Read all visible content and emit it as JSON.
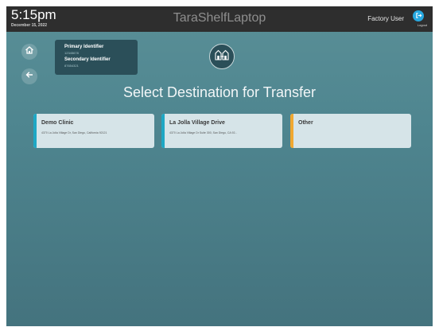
{
  "header": {
    "time": "5:15pm",
    "date": "December 15, 2022",
    "app_title": "TaraShelfLaptop",
    "user_name": "Factory User",
    "logout_label": "Logout"
  },
  "icons": {
    "home": "home-icon",
    "back": "arrow-left-icon",
    "transfer": "transfer-icon",
    "logout": "logout-icon"
  },
  "identifiers": {
    "primary_label": "Primary Identifier",
    "primary_value": "12345678",
    "secondary_label": "Secondary Identifier",
    "secondary_value": "87654321"
  },
  "main": {
    "heading": "Select Destination for Transfer"
  },
  "destinations": [
    {
      "name": "Demo Clinic",
      "address": "4370 La Jolla Village Dr, San Diego, California 92121",
      "accent": "#1ea7c4"
    },
    {
      "name": "La Jolla Village Drive",
      "address": "4370 La Jolla Village Dr Suite 300, San Diego, CA 92...",
      "accent": "#1ea7c4"
    },
    {
      "name": "Other",
      "address": "",
      "accent": "#f0a830"
    }
  ],
  "colors": {
    "topbar": "#2e2e2e",
    "background": "#4f8690",
    "card": "#d6e4e8",
    "accent_blue": "#1ea7c4",
    "accent_orange": "#f0a830",
    "logout_button": "#27a9e1"
  }
}
